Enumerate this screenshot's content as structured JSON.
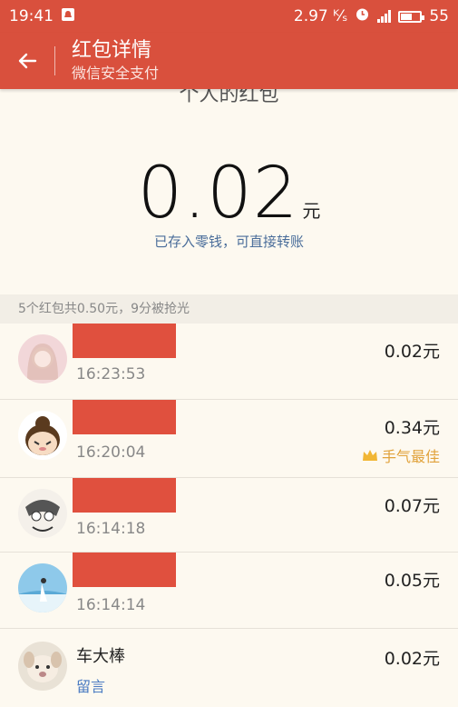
{
  "status_bar": {
    "time": "19:41",
    "speed": "2.97 ᴷ⁄ₛ",
    "battery": "55"
  },
  "header": {
    "title": "红包详情",
    "subtitle": "微信安全支付"
  },
  "clipped_title": "个人的红包",
  "amount": {
    "value": "0.02",
    "unit": "元"
  },
  "stored_text": "已存入零钱，可直接转账",
  "summary": "5个红包共0.50元，9分被抢光",
  "entries": [
    {
      "time": "16:23:53",
      "amount": "0.02元"
    },
    {
      "time": "16:20:04",
      "amount": "0.34元",
      "badge": "手气最佳"
    },
    {
      "time": "16:14:18",
      "amount": "0.07元"
    },
    {
      "time": "16:14:14",
      "amount": "0.05元"
    },
    {
      "name": "车大棒",
      "amount": "0.02元",
      "message": "留言"
    }
  ]
}
